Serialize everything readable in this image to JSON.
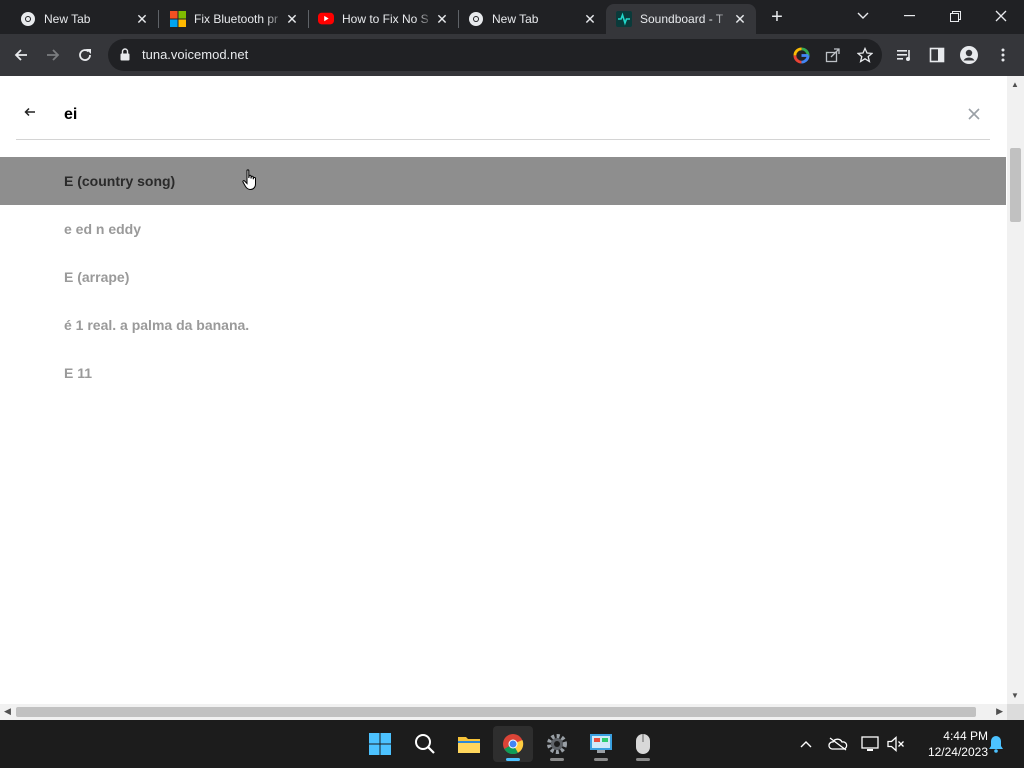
{
  "tabs": [
    {
      "title": "New Tab",
      "icon": "chrome-icon"
    },
    {
      "title": "Fix Bluetooth pr",
      "icon": "microsoft-icon"
    },
    {
      "title": "How to Fix No S",
      "icon": "youtube-icon"
    },
    {
      "title": "New Tab",
      "icon": "chrome-icon"
    },
    {
      "title": "Soundboard - T",
      "icon": "voicemod-icon"
    }
  ],
  "address_bar": {
    "url": "tuna.voicemod.net"
  },
  "search": {
    "query": "ei"
  },
  "results": [
    "E (country song)",
    "e ed n eddy",
    "E (arrape)",
    "é 1 real. a palma da banana.",
    "E 11"
  ],
  "clock": {
    "time": "4:44 PM",
    "date": "12/24/2023"
  },
  "colors": {
    "accent": "#4cc2ff",
    "hover_row": "#8e8e8e"
  }
}
